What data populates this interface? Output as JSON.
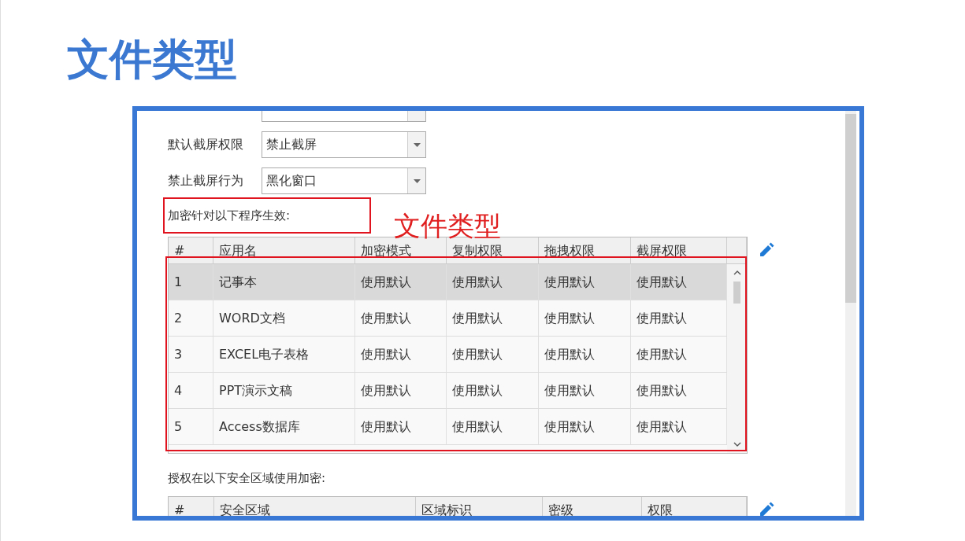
{
  "title": "文件类型",
  "settings": [
    {
      "label": "默认截屏权限",
      "value": "禁止截屏"
    },
    {
      "label": "禁止截屏行为",
      "value": "黑化窗口"
    }
  ],
  "apps_section": {
    "label": "加密针对以下程序生效:",
    "columns": [
      "#",
      "应用名",
      "加密模式",
      "复制权限",
      "拖拽权限",
      "截屏权限"
    ],
    "rows": [
      {
        "cells": [
          "1",
          "记事本",
          "使用默认",
          "使用默认",
          "使用默认",
          "使用默认"
        ],
        "selected": true
      },
      {
        "cells": [
          "2",
          "WORD文档",
          "使用默认",
          "使用默认",
          "使用默认",
          "使用默认"
        ],
        "selected": false
      },
      {
        "cells": [
          "3",
          "EXCEL电子表格",
          "使用默认",
          "使用默认",
          "使用默认",
          "使用默认"
        ],
        "selected": false
      },
      {
        "cells": [
          "4",
          "PPT演示文稿",
          "使用默认",
          "使用默认",
          "使用默认",
          "使用默认"
        ],
        "selected": false
      },
      {
        "cells": [
          "5",
          "Access数据库",
          "使用默认",
          "使用默认",
          "使用默认",
          "使用默认"
        ],
        "selected": false
      }
    ]
  },
  "annotation": {
    "label": "文件类型"
  },
  "zones_section": {
    "label": "授权在以下安全区域使用加密:",
    "columns": [
      "#",
      "安全区域",
      "区域标识",
      "密级",
      "权限"
    ]
  }
}
